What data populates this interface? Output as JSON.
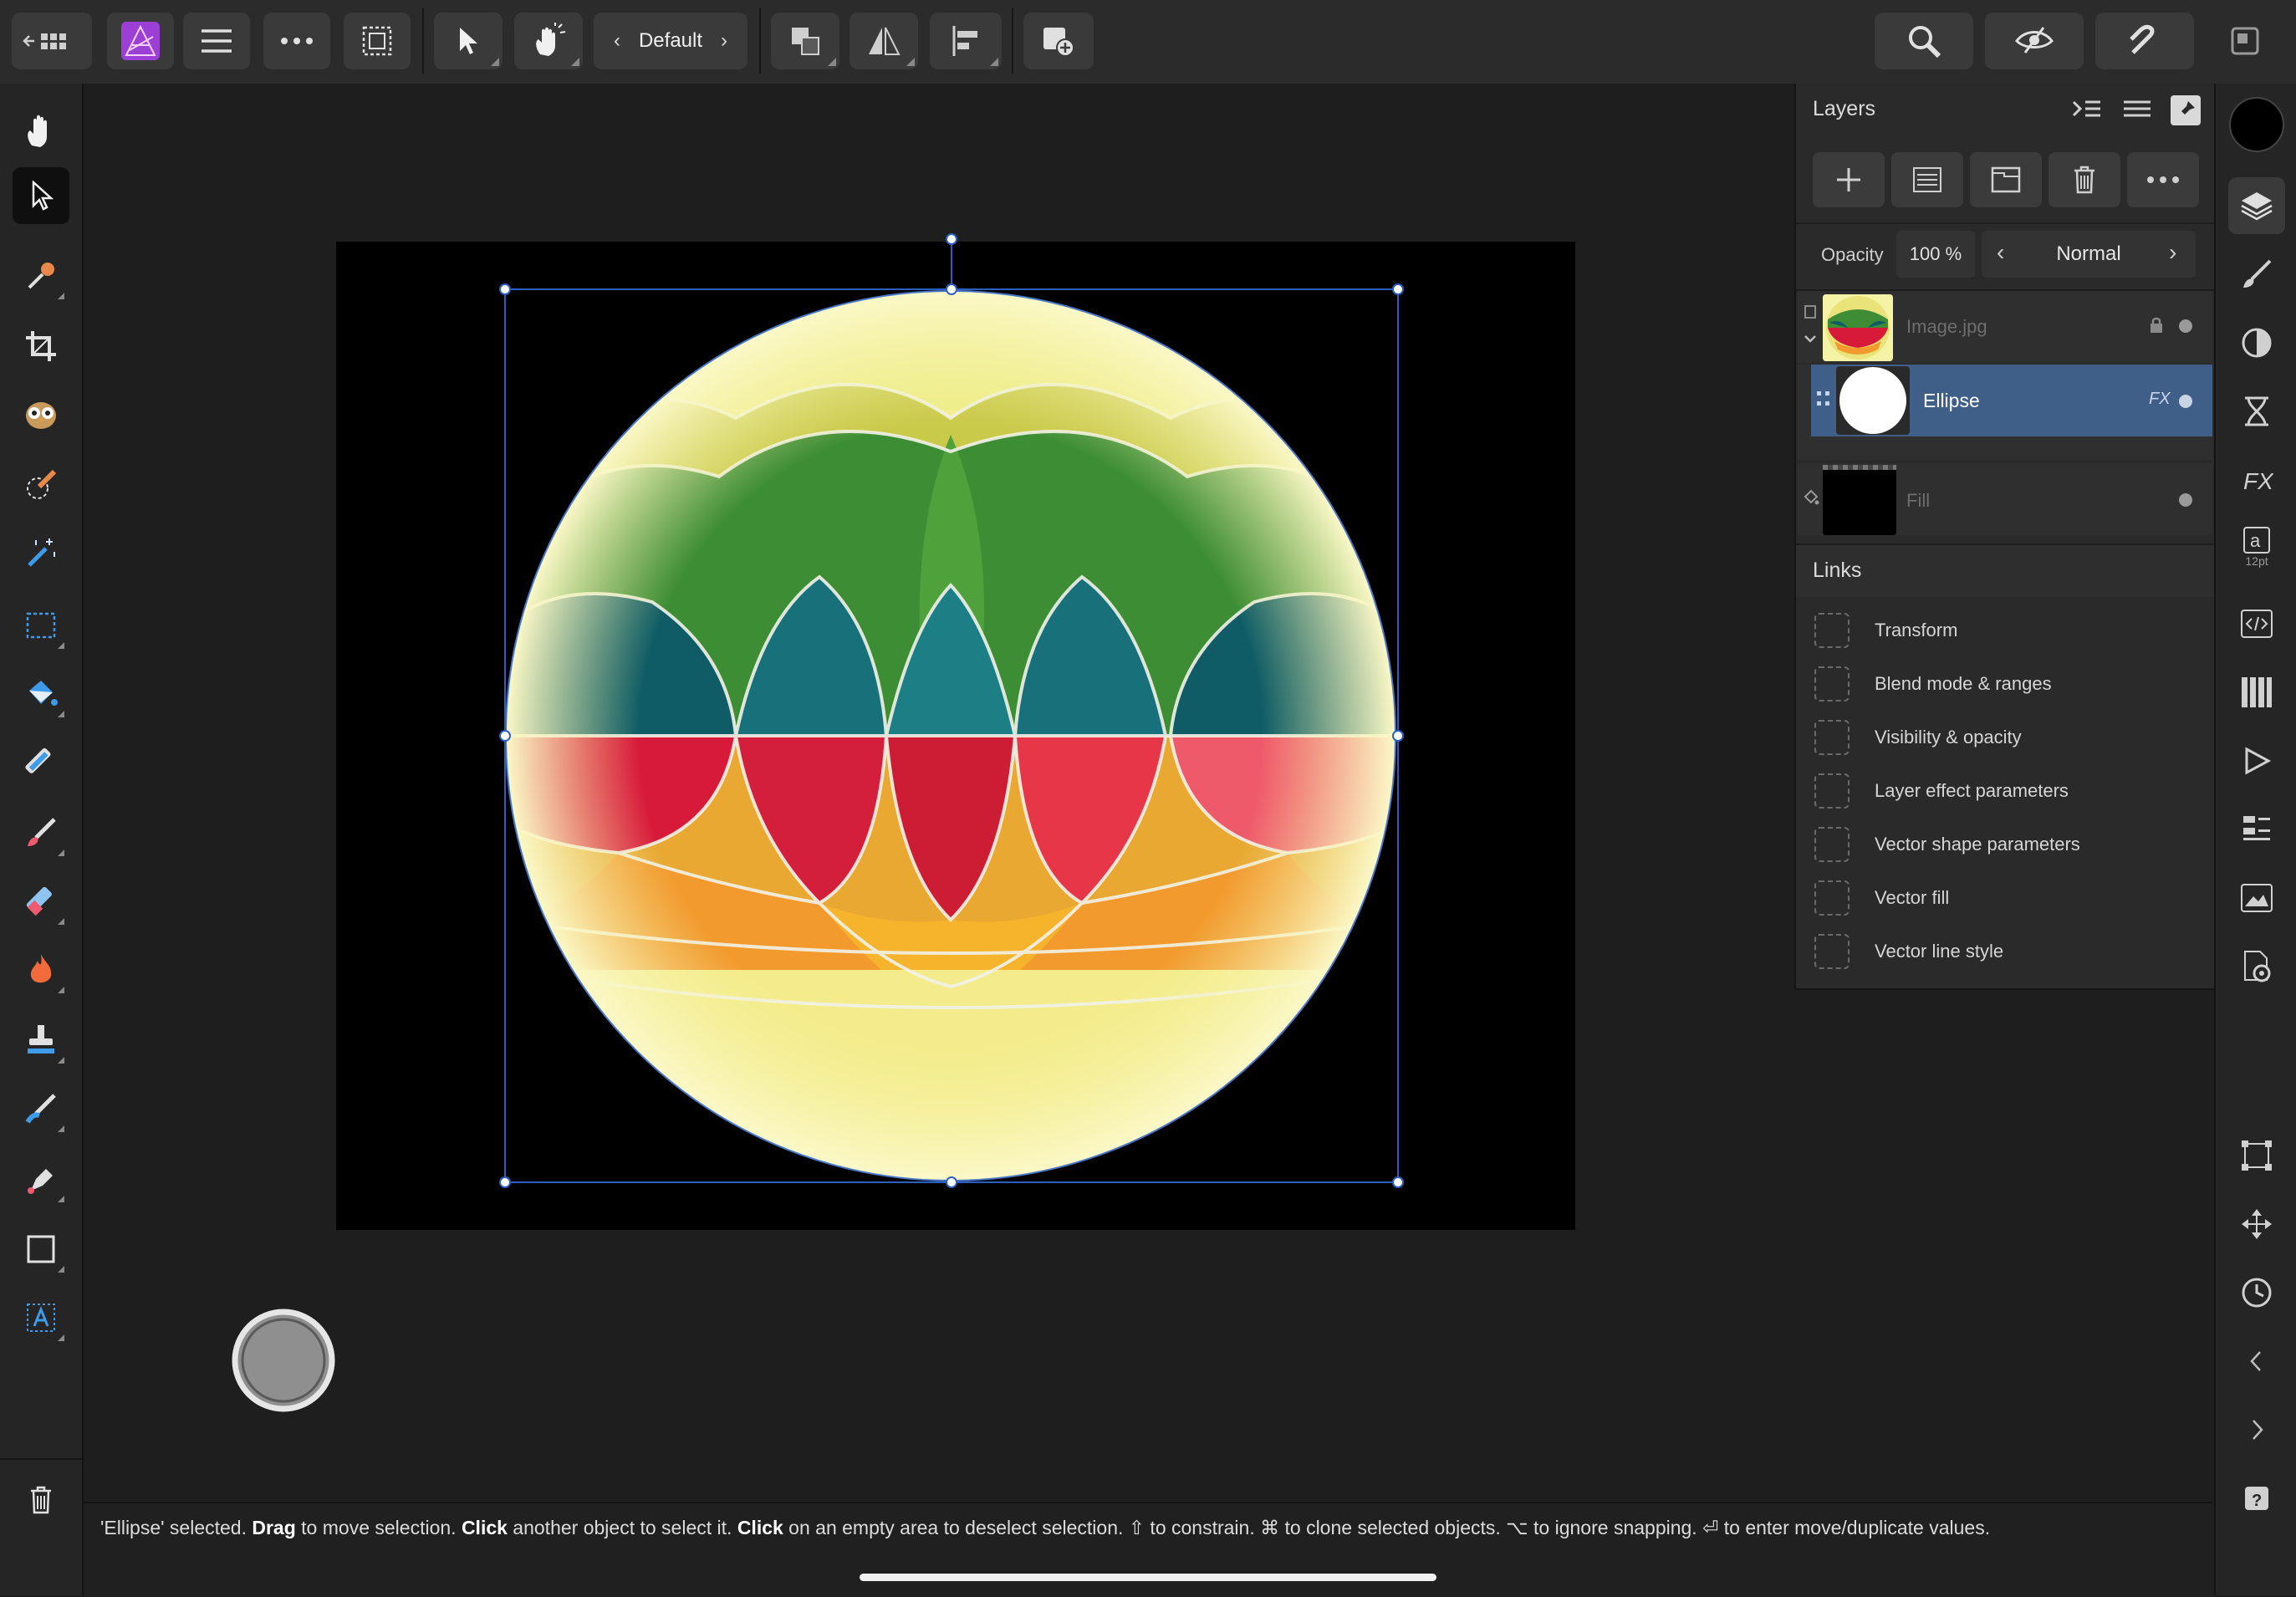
{
  "toolbar": {
    "persona_label": "Default"
  },
  "layers_panel": {
    "title": "Layers",
    "opacity_label": "Opacity",
    "opacity_value": "100 %",
    "blend_mode": "Normal",
    "layers": [
      {
        "name": "Image.jpg",
        "locked": true,
        "selected": false,
        "child": false
      },
      {
        "name": "Ellipse",
        "fx": "FX",
        "selected": true,
        "child": true
      },
      {
        "name": "Fill",
        "selected": false,
        "child": false
      }
    ]
  },
  "links_panel": {
    "title": "Links",
    "items": [
      "Transform",
      "Blend mode & ranges",
      "Visibility & opacity",
      "Layer effect parameters",
      "Vector shape parameters",
      "Vector fill",
      "Vector line style"
    ]
  },
  "right_bar": {
    "text_size_label": "12pt"
  },
  "status": {
    "t1": "'Ellipse' selected. ",
    "b1": "Drag",
    "t2": " to move selection. ",
    "b2": "Click",
    "t3": " another object to select it. ",
    "b3": "Click",
    "t4": " on an empty area to deselect selection. ⇧ to constrain. ⌘ to clone selected objects. ⌥ to ignore snapping. ⏎ to enter move/duplicate values."
  },
  "colors": {
    "accent_selection": "#3f5f88",
    "primary_color": "#000000",
    "app_icon": "#9b3fd6"
  }
}
